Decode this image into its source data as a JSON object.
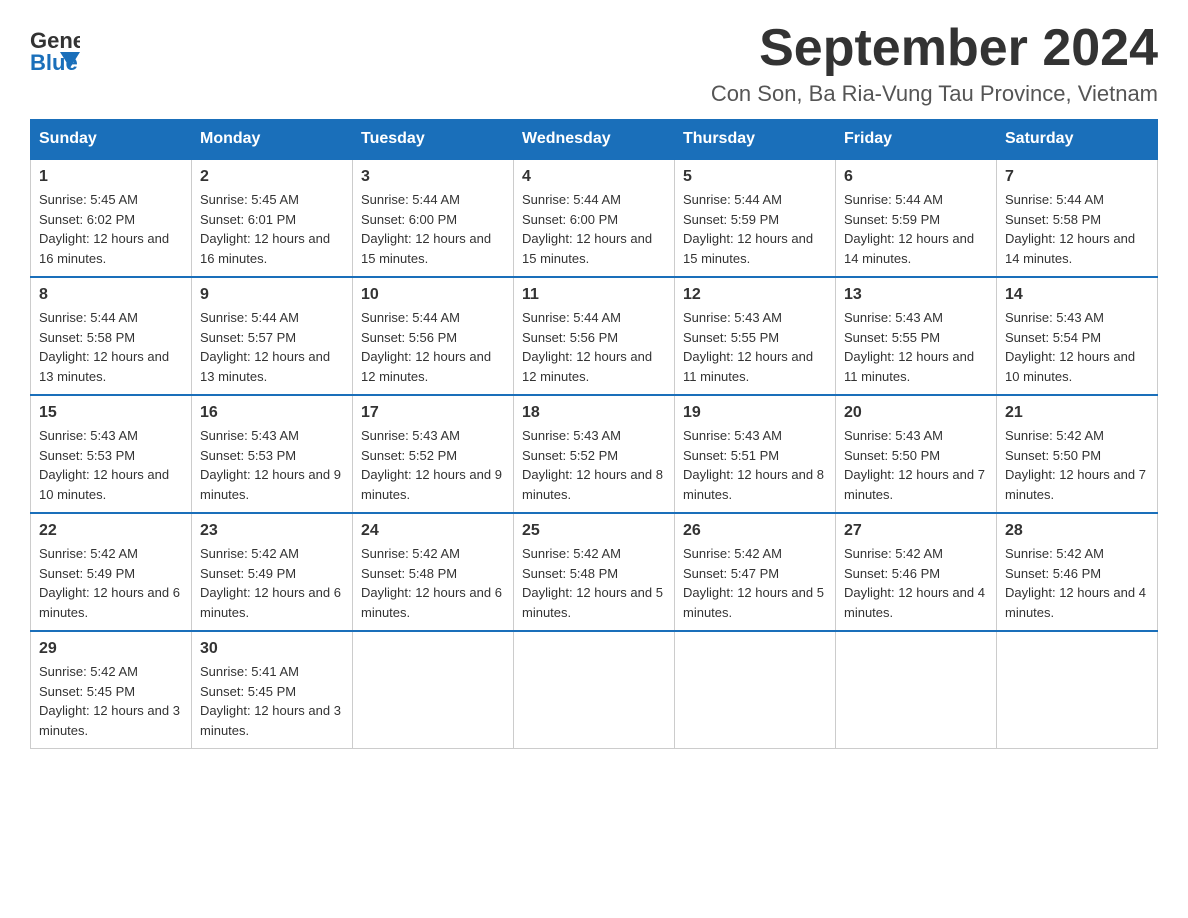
{
  "logo": {
    "text_general": "General",
    "text_blue": "Blue"
  },
  "title": {
    "month_year": "September 2024",
    "location": "Con Son, Ba Ria-Vung Tau Province, Vietnam"
  },
  "weekdays": [
    "Sunday",
    "Monday",
    "Tuesday",
    "Wednesday",
    "Thursday",
    "Friday",
    "Saturday"
  ],
  "weeks": [
    [
      {
        "day": "1",
        "sunrise": "5:45 AM",
        "sunset": "6:02 PM",
        "daylight": "12 hours and 16 minutes."
      },
      {
        "day": "2",
        "sunrise": "5:45 AM",
        "sunset": "6:01 PM",
        "daylight": "12 hours and 16 minutes."
      },
      {
        "day": "3",
        "sunrise": "5:44 AM",
        "sunset": "6:00 PM",
        "daylight": "12 hours and 15 minutes."
      },
      {
        "day": "4",
        "sunrise": "5:44 AM",
        "sunset": "6:00 PM",
        "daylight": "12 hours and 15 minutes."
      },
      {
        "day": "5",
        "sunrise": "5:44 AM",
        "sunset": "5:59 PM",
        "daylight": "12 hours and 15 minutes."
      },
      {
        "day": "6",
        "sunrise": "5:44 AM",
        "sunset": "5:59 PM",
        "daylight": "12 hours and 14 minutes."
      },
      {
        "day": "7",
        "sunrise": "5:44 AM",
        "sunset": "5:58 PM",
        "daylight": "12 hours and 14 minutes."
      }
    ],
    [
      {
        "day": "8",
        "sunrise": "5:44 AM",
        "sunset": "5:58 PM",
        "daylight": "12 hours and 13 minutes."
      },
      {
        "day": "9",
        "sunrise": "5:44 AM",
        "sunset": "5:57 PM",
        "daylight": "12 hours and 13 minutes."
      },
      {
        "day": "10",
        "sunrise": "5:44 AM",
        "sunset": "5:56 PM",
        "daylight": "12 hours and 12 minutes."
      },
      {
        "day": "11",
        "sunrise": "5:44 AM",
        "sunset": "5:56 PM",
        "daylight": "12 hours and 12 minutes."
      },
      {
        "day": "12",
        "sunrise": "5:43 AM",
        "sunset": "5:55 PM",
        "daylight": "12 hours and 11 minutes."
      },
      {
        "day": "13",
        "sunrise": "5:43 AM",
        "sunset": "5:55 PM",
        "daylight": "12 hours and 11 minutes."
      },
      {
        "day": "14",
        "sunrise": "5:43 AM",
        "sunset": "5:54 PM",
        "daylight": "12 hours and 10 minutes."
      }
    ],
    [
      {
        "day": "15",
        "sunrise": "5:43 AM",
        "sunset": "5:53 PM",
        "daylight": "12 hours and 10 minutes."
      },
      {
        "day": "16",
        "sunrise": "5:43 AM",
        "sunset": "5:53 PM",
        "daylight": "12 hours and 9 minutes."
      },
      {
        "day": "17",
        "sunrise": "5:43 AM",
        "sunset": "5:52 PM",
        "daylight": "12 hours and 9 minutes."
      },
      {
        "day": "18",
        "sunrise": "5:43 AM",
        "sunset": "5:52 PM",
        "daylight": "12 hours and 8 minutes."
      },
      {
        "day": "19",
        "sunrise": "5:43 AM",
        "sunset": "5:51 PM",
        "daylight": "12 hours and 8 minutes."
      },
      {
        "day": "20",
        "sunrise": "5:43 AM",
        "sunset": "5:50 PM",
        "daylight": "12 hours and 7 minutes."
      },
      {
        "day": "21",
        "sunrise": "5:42 AM",
        "sunset": "5:50 PM",
        "daylight": "12 hours and 7 minutes."
      }
    ],
    [
      {
        "day": "22",
        "sunrise": "5:42 AM",
        "sunset": "5:49 PM",
        "daylight": "12 hours and 6 minutes."
      },
      {
        "day": "23",
        "sunrise": "5:42 AM",
        "sunset": "5:49 PM",
        "daylight": "12 hours and 6 minutes."
      },
      {
        "day": "24",
        "sunrise": "5:42 AM",
        "sunset": "5:48 PM",
        "daylight": "12 hours and 6 minutes."
      },
      {
        "day": "25",
        "sunrise": "5:42 AM",
        "sunset": "5:48 PM",
        "daylight": "12 hours and 5 minutes."
      },
      {
        "day": "26",
        "sunrise": "5:42 AM",
        "sunset": "5:47 PM",
        "daylight": "12 hours and 5 minutes."
      },
      {
        "day": "27",
        "sunrise": "5:42 AM",
        "sunset": "5:46 PM",
        "daylight": "12 hours and 4 minutes."
      },
      {
        "day": "28",
        "sunrise": "5:42 AM",
        "sunset": "5:46 PM",
        "daylight": "12 hours and 4 minutes."
      }
    ],
    [
      {
        "day": "29",
        "sunrise": "5:42 AM",
        "sunset": "5:45 PM",
        "daylight": "12 hours and 3 minutes."
      },
      {
        "day": "30",
        "sunrise": "5:41 AM",
        "sunset": "5:45 PM",
        "daylight": "12 hours and 3 minutes."
      },
      null,
      null,
      null,
      null,
      null
    ]
  ]
}
